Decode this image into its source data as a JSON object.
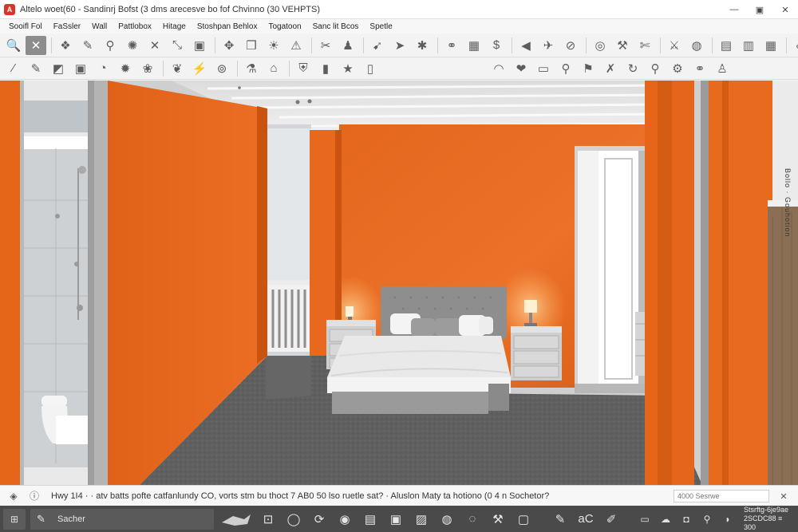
{
  "window": {
    "title": "Altelo woet(60 - Sandinrj Bofst (3 dms arecesve bo fof Chvinno (30 VEHPTS)",
    "logo_letter": "A",
    "minimize_glyph": "—",
    "maximize_glyph": "▣",
    "close_glyph": "✕"
  },
  "menu": {
    "items": [
      "Sooifl Fol",
      "FaSsler",
      "Wall",
      "Pattlobox",
      "Hitage",
      "Stoshpan Behlox",
      "Togatoon",
      "Sanc lit Bcos",
      "Spetle"
    ]
  },
  "toolbar1": {
    "icons": [
      {
        "name": "zoom-icon",
        "glyph": "🔍"
      },
      {
        "name": "select-icon",
        "glyph": "✕",
        "active": true
      },
      {
        "name": "sep"
      },
      {
        "name": "paint-icon",
        "glyph": "❖"
      },
      {
        "name": "pencil-icon",
        "glyph": "✎"
      },
      {
        "name": "wand-icon",
        "glyph": "⚲"
      },
      {
        "name": "gear-icon",
        "glyph": "✺"
      },
      {
        "name": "cross-icon",
        "glyph": "✕"
      },
      {
        "name": "resize-icon",
        "glyph": "⤡"
      },
      {
        "name": "box-icon",
        "glyph": "▣"
      },
      {
        "name": "sep"
      },
      {
        "name": "move-icon",
        "glyph": "✥"
      },
      {
        "name": "cube-icon",
        "glyph": "❒"
      },
      {
        "name": "sun-icon",
        "glyph": "☀"
      },
      {
        "name": "warning-icon",
        "glyph": "⚠"
      },
      {
        "name": "sep"
      },
      {
        "name": "tag-icon",
        "glyph": "✂"
      },
      {
        "name": "robot-icon",
        "glyph": "♟"
      },
      {
        "name": "sep"
      },
      {
        "name": "arrow-icon",
        "glyph": "➹"
      },
      {
        "name": "cursor-icon",
        "glyph": "➤"
      },
      {
        "name": "star-icon",
        "glyph": "✱"
      },
      {
        "name": "sep"
      },
      {
        "name": "link-icon",
        "glyph": "⚭"
      },
      {
        "name": "grid-icon",
        "glyph": "▦"
      },
      {
        "name": "dollar-icon",
        "glyph": "$"
      },
      {
        "name": "sep"
      },
      {
        "name": "back-icon",
        "glyph": "◀"
      },
      {
        "name": "share-icon",
        "glyph": "✈"
      },
      {
        "name": "magnify-icon",
        "glyph": "⊘"
      },
      {
        "name": "sep"
      },
      {
        "name": "target-icon",
        "glyph": "◎"
      },
      {
        "name": "tools-icon",
        "glyph": "⚒"
      },
      {
        "name": "scissors-icon",
        "glyph": "✄"
      },
      {
        "name": "sep"
      },
      {
        "name": "hammer-icon",
        "glyph": "⚔"
      },
      {
        "name": "globe-icon",
        "glyph": "◍"
      },
      {
        "name": "sep"
      },
      {
        "name": "window-icon",
        "glyph": "▤"
      },
      {
        "name": "panel-icon",
        "glyph": "▥"
      },
      {
        "name": "table-icon",
        "glyph": "▦"
      },
      {
        "name": "sep"
      },
      {
        "name": "edit-icon",
        "glyph": "✐"
      },
      {
        "name": "layout-icon",
        "glyph": "▧"
      },
      {
        "name": "house-icon",
        "glyph": "⌂"
      },
      {
        "name": "list-icon",
        "glyph": "☰"
      }
    ]
  },
  "toolbar2": {
    "icons": [
      {
        "name": "brush-icon",
        "glyph": "⁄"
      },
      {
        "name": "sketch-icon",
        "glyph": "✎"
      },
      {
        "name": "image-icon",
        "glyph": "◩"
      },
      {
        "name": "photo-icon",
        "glyph": "▣"
      },
      {
        "name": "pie-icon",
        "glyph": "◔"
      },
      {
        "name": "burst-icon",
        "glyph": "✹"
      },
      {
        "name": "tree-icon",
        "glyph": "❀"
      },
      {
        "name": "sep"
      },
      {
        "name": "leaf-icon",
        "glyph": "❦"
      },
      {
        "name": "bolt-icon",
        "glyph": "⚡"
      },
      {
        "name": "target-small-icon",
        "glyph": "⊚"
      },
      {
        "name": "sep"
      },
      {
        "name": "spray-icon",
        "glyph": "⚗"
      },
      {
        "name": "house-small-icon",
        "glyph": "⌂"
      },
      {
        "name": "sep"
      },
      {
        "name": "shield-icon",
        "glyph": "⛨"
      },
      {
        "name": "bars-icon",
        "glyph": "▮"
      },
      {
        "name": "star-small-icon",
        "glyph": "★"
      },
      {
        "name": "column-icon",
        "glyph": "▯"
      }
    ],
    "right_icons": [
      {
        "name": "wifi-icon",
        "glyph": "◠"
      },
      {
        "name": "heart-icon",
        "glyph": "❤"
      },
      {
        "name": "chat-icon",
        "glyph": "▭"
      },
      {
        "name": "search-small-icon",
        "glyph": "⚲"
      },
      {
        "name": "flag-icon",
        "glyph": "⚑"
      },
      {
        "name": "tools-small-icon",
        "glyph": "✗"
      },
      {
        "name": "rotate-icon",
        "glyph": "↻"
      },
      {
        "name": "pin-icon",
        "glyph": "⚲"
      },
      {
        "name": "gear-small-icon",
        "glyph": "⚙"
      },
      {
        "name": "link-small-icon",
        "glyph": "⚭"
      },
      {
        "name": "person-icon",
        "glyph": "♙"
      }
    ]
  },
  "viewport": {
    "side_label": "Bollo · Gouhotion",
    "colors": {
      "wall_orange": "#ea6a1f",
      "wall_orange_dark": "#d55a12",
      "carpet": "#5f5f5f",
      "ceiling": "#e9e9e9",
      "furniture": "#c9c9c9"
    }
  },
  "statusbar": {
    "text": "Hwy 1I4 · · atv batts pofte catfanlundy CO, vorts stm bu thoct 7 AB0 50 lso ruetle sat? · Aluslon Maty ta hotiono (0 4 n Sochetor?",
    "search_placeholder": "4000 Sesrwe",
    "left_icon": "◈",
    "info_icon": "ⓘ",
    "close_icon": "✕"
  },
  "taskbar": {
    "start_glyph": "⊞",
    "search_icon": "✎",
    "search_label": "Sacher",
    "apps": [
      {
        "name": "scan-app-icon",
        "glyph": "⊡"
      },
      {
        "name": "circle-app-icon",
        "glyph": "◯"
      },
      {
        "name": "refresh-app-icon",
        "glyph": "⟳"
      },
      {
        "name": "disc-app-icon",
        "glyph": "◉"
      },
      {
        "name": "folder-app-icon",
        "glyph": "▤"
      },
      {
        "name": "device-app-icon",
        "glyph": "▣"
      },
      {
        "name": "chart-app-icon",
        "glyph": "▨"
      },
      {
        "name": "globe-app-icon",
        "glyph": "◍"
      },
      {
        "name": "ring-app-icon",
        "glyph": "◌"
      },
      {
        "name": "wrench-app-icon",
        "glyph": "⚒"
      },
      {
        "name": "box-app-icon",
        "glyph": "▢"
      }
    ],
    "right_apps": [
      {
        "name": "pen-app-icon",
        "glyph": "✎"
      },
      {
        "name": "ac-app-label",
        "glyph": "aC"
      },
      {
        "name": "pen2-app-icon",
        "glyph": "✐"
      }
    ],
    "tray": [
      {
        "name": "tray-chat-icon",
        "glyph": "▭"
      },
      {
        "name": "tray-cloud-icon",
        "glyph": "☁"
      },
      {
        "name": "tray-bag-icon",
        "glyph": "◘"
      },
      {
        "name": "tray-pin-icon",
        "glyph": "⚲"
      },
      {
        "name": "tray-sound-icon",
        "glyph": "◗"
      }
    ],
    "clock_line1": "Stsrftg-6je9ae",
    "clock_line2": "2SCDC88 ≡ 300"
  }
}
